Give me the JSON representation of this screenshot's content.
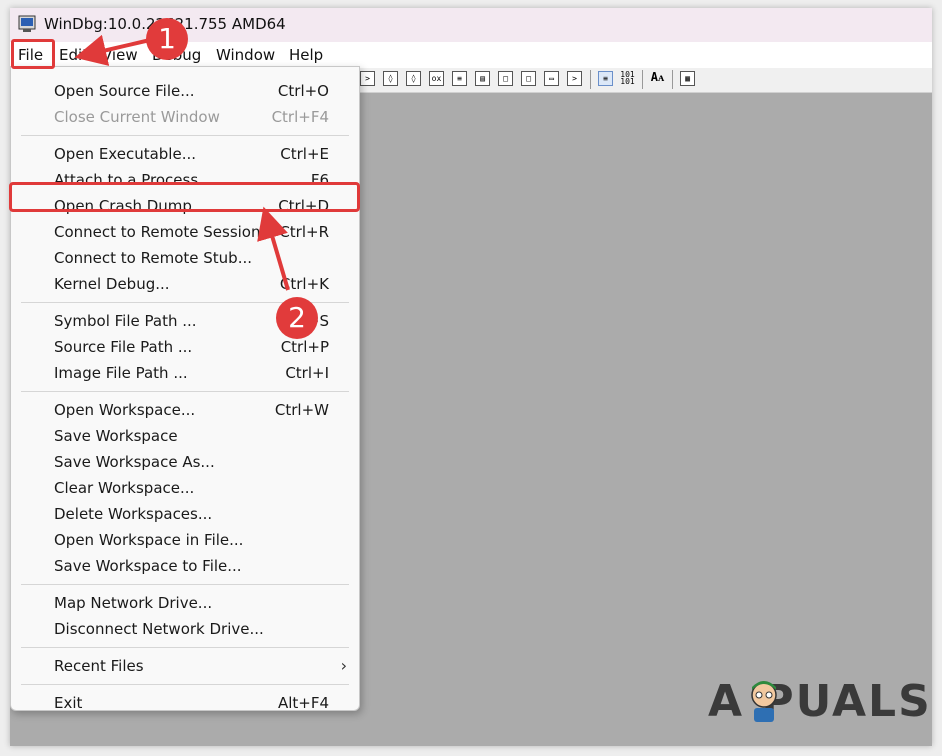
{
  "window": {
    "title": "WinDbg:10.0.22621.755 AMD64"
  },
  "menubar": {
    "items": [
      "File",
      "Edit",
      "View",
      "Debug",
      "Window",
      "Help"
    ]
  },
  "file_menu": {
    "items": [
      {
        "label": "Open Source File...",
        "shortcut": "Ctrl+O",
        "enabled": true
      },
      {
        "label": "Close Current Window",
        "shortcut": "Ctrl+F4",
        "enabled": false
      },
      {
        "label": "Open Executable...",
        "shortcut": "Ctrl+E",
        "enabled": true
      },
      {
        "label": "Attach to a Process...",
        "shortcut": "F6",
        "enabled": true
      },
      {
        "label": "Open Crash Dump...",
        "shortcut": "Ctrl+D",
        "enabled": true
      },
      {
        "label": "Connect to Remote Session...",
        "shortcut": "Ctrl+R",
        "enabled": true
      },
      {
        "label": "Connect to Remote Stub...",
        "shortcut": "",
        "enabled": true
      },
      {
        "label": "Kernel Debug...",
        "shortcut": "Ctrl+K",
        "enabled": true
      },
      {
        "label": "Symbol File Path ...",
        "shortcut": "Ctrl+S",
        "enabled": true
      },
      {
        "label": "Source File Path ...",
        "shortcut": "Ctrl+P",
        "enabled": true
      },
      {
        "label": "Image File Path ...",
        "shortcut": "Ctrl+I",
        "enabled": true
      },
      {
        "label": "Open Workspace...",
        "shortcut": "Ctrl+W",
        "enabled": true
      },
      {
        "label": "Save Workspace",
        "shortcut": "",
        "enabled": true
      },
      {
        "label": "Save Workspace As...",
        "shortcut": "",
        "enabled": true
      },
      {
        "label": "Clear Workspace...",
        "shortcut": "",
        "enabled": true
      },
      {
        "label": "Delete Workspaces...",
        "shortcut": "",
        "enabled": true
      },
      {
        "label": "Open Workspace in File...",
        "shortcut": "",
        "enabled": true
      },
      {
        "label": "Save Workspace to File...",
        "shortcut": "",
        "enabled": true
      },
      {
        "label": "Map Network Drive...",
        "shortcut": "",
        "enabled": true
      },
      {
        "label": "Disconnect Network Drive...",
        "shortcut": "",
        "enabled": true
      },
      {
        "label": "Recent Files",
        "shortcut": "",
        "enabled": true
      },
      {
        "label": "Exit",
        "shortcut": "Alt+F4",
        "enabled": true
      }
    ]
  },
  "annotations": {
    "step1": "1",
    "step2": "2",
    "highlight_color": "#e03a3a"
  },
  "watermark": "A  PUALS"
}
